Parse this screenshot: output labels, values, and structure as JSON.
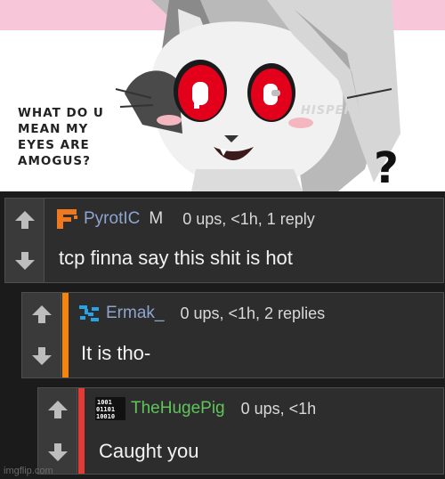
{
  "meme": {
    "caption_lines": [
      "WHAT DO U",
      "MEAN MY",
      "EYES ARE",
      "AMOGUS?"
    ],
    "watermark": "HISPERFOOT"
  },
  "comments": [
    {
      "username": "PyrotIC",
      "flag": "M",
      "meta": "0 ups, <1h, 1 reply",
      "text": "tcp finna say this shit is hot",
      "avatar_icon": "f-logo-icon",
      "stripe_color": null,
      "username_color": "#8fa4cf"
    },
    {
      "username": "Ermak_",
      "flag": "",
      "meta": "0 ups, <1h, 2 replies",
      "text": "It is tho-",
      "avatar_icon": "blue-pixel-icon",
      "stripe_color": "#f5850f",
      "username_color": "#8fa4cf"
    },
    {
      "username": "TheHugePig",
      "flag": "",
      "meta": "0 ups, <1h",
      "text": "Caught you",
      "avatar_icon": "binary-avatar-icon",
      "avatar_text": [
        "1001",
        "01101",
        "10010"
      ],
      "stripe_color": "#e23a34",
      "username_color": "#5fc45a"
    }
  ],
  "footer": {
    "site_watermark": "imgflip.com"
  }
}
